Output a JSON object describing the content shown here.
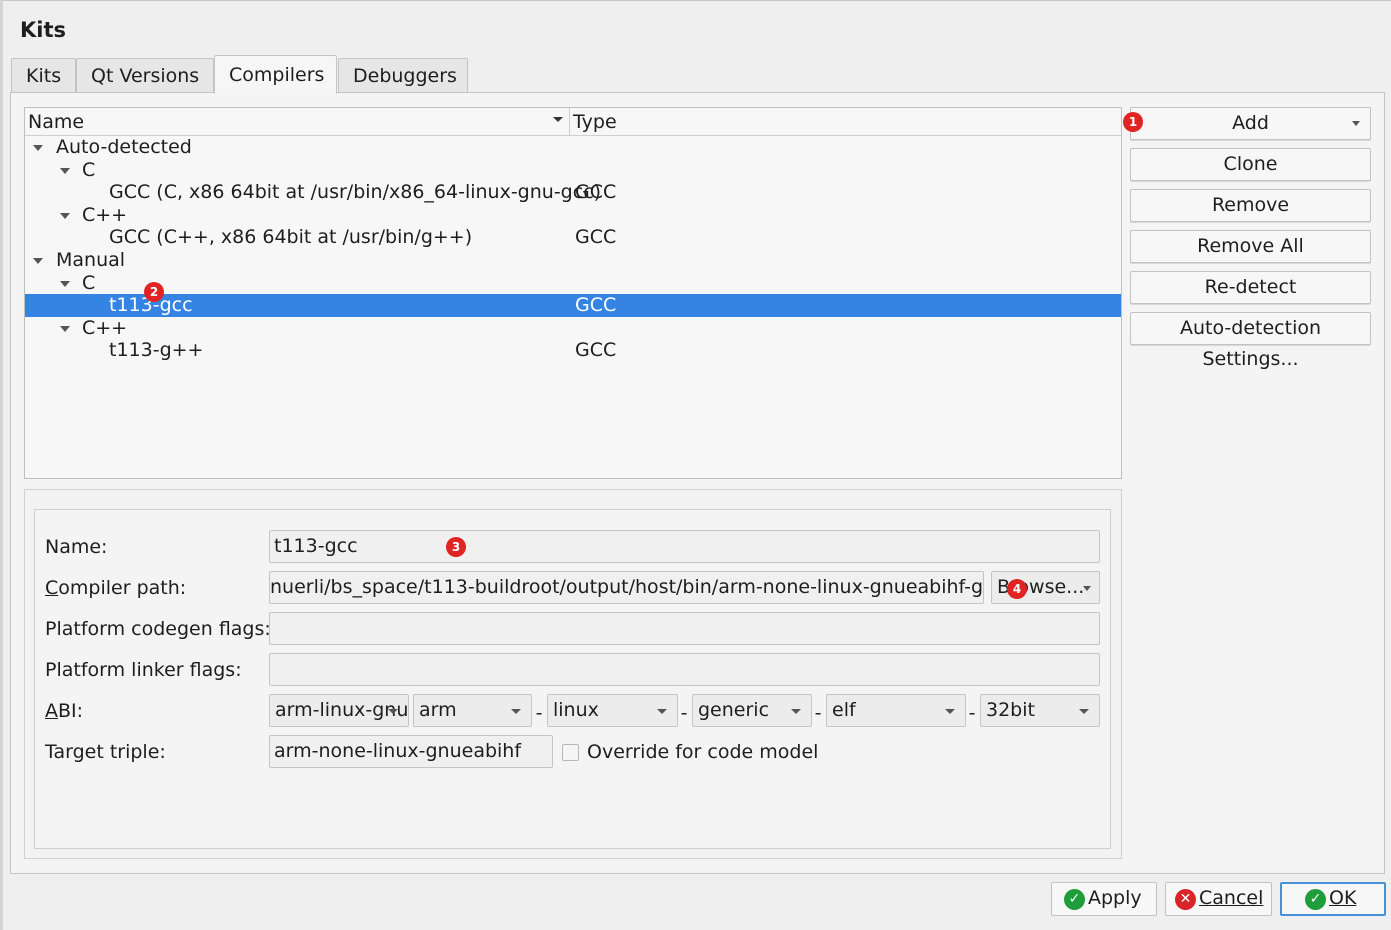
{
  "title": "Kits",
  "tabs": [
    "Kits",
    "Qt Versions",
    "Compilers",
    "Debuggers"
  ],
  "active_tab": "Compilers",
  "tree": {
    "columns": [
      "Name",
      "Type"
    ],
    "rows": [
      {
        "label": "Auto-detected",
        "type": ""
      },
      {
        "label": "C",
        "type": ""
      },
      {
        "label": "GCC (C, x86 64bit at /usr/bin/x86_64-linux-gnu-gcc)",
        "type": "GCC"
      },
      {
        "label": "C++",
        "type": ""
      },
      {
        "label": "GCC (C++, x86 64bit at /usr/bin/g++)",
        "type": "GCC"
      },
      {
        "label": "Manual",
        "type": ""
      },
      {
        "label": "C",
        "type": ""
      },
      {
        "label": "t113-gcc",
        "type": "GCC"
      },
      {
        "label": "C++",
        "type": ""
      },
      {
        "label": "t113-g++",
        "type": "GCC"
      }
    ]
  },
  "side_buttons": [
    "Add",
    "Clone",
    "Remove",
    "Remove All",
    "Re-detect",
    "Auto-detection Settings..."
  ],
  "details": {
    "name_label": "Name:",
    "name_value": "t113-gcc",
    "compiler_path_label": "Compiler path:",
    "compiler_path_value": "nuerli/bs_space/t113-buildroot/output/host/bin/arm-none-linux-gnueabihf-gcc",
    "browse_label": "Browse...",
    "codegen_label": "Platform codegen flags:",
    "codegen_value": "",
    "linker_label": "Platform linker flags:",
    "linker_value": "",
    "abi_label": "ABI:",
    "abi": [
      "arm-linux-gnueabihf",
      "arm",
      "linux",
      "generic",
      "elf",
      "32bit"
    ],
    "abi_sep": "-",
    "triple_label": "Target triple:",
    "triple_value": "arm-none-linux-gnueabihf",
    "override_label": "Override for code model",
    "override_checked": false
  },
  "badges": [
    "1",
    "2",
    "3",
    "4"
  ],
  "bottom_buttons": {
    "apply": "Apply",
    "cancel": "Cancel",
    "ok": "OK"
  },
  "colors": {
    "selection": "#3584e4",
    "badge": "#e02424",
    "apply_icon": "#1f9d3a",
    "cancel_icon": "#d9242a"
  },
  "icons": {
    "apply": "check-circle-icon",
    "cancel": "x-circle-icon",
    "ok": "check-circle-icon",
    "expand": "caret-down-icon"
  }
}
